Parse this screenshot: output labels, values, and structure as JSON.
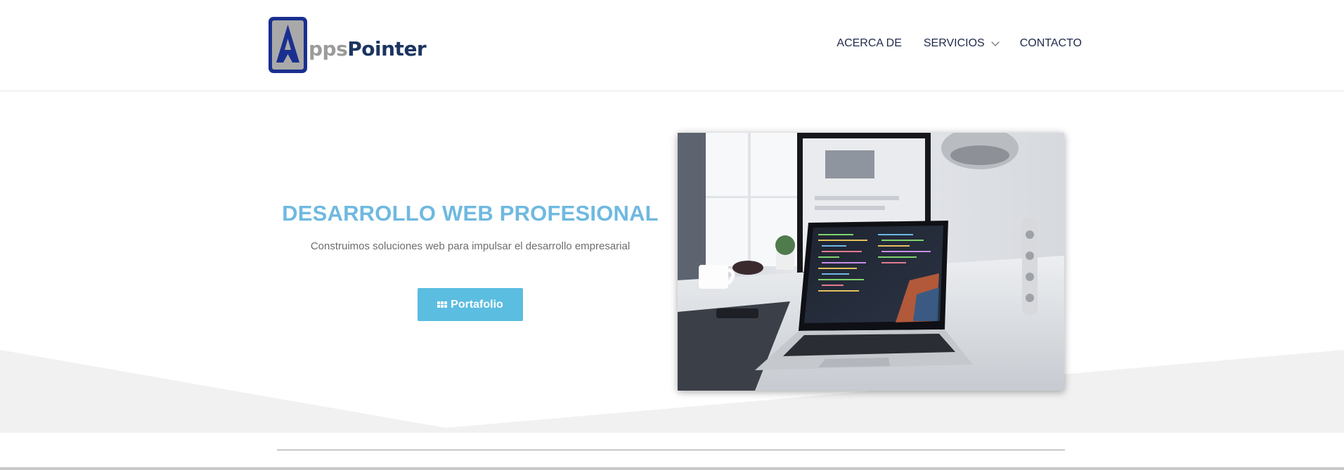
{
  "header": {
    "logo": {
      "text_part1": "pps",
      "text_part2": "Pointer",
      "alt": "AppsPointer"
    },
    "nav": [
      {
        "label": "ACERCA DE",
        "has_dropdown": false
      },
      {
        "label": "SERVICIOS",
        "has_dropdown": true
      },
      {
        "label": "CONTACTO",
        "has_dropdown": false
      }
    ]
  },
  "hero": {
    "title": "DESARROLLO WEB PROFESIONAL",
    "subtitle": "Construimos soluciones web para impulsar el desarrollo empresarial",
    "button": {
      "label": "Portafolio",
      "icon": "grid-icon"
    },
    "image": {
      "subject": "laptop-on-desk-photo"
    }
  },
  "colors": {
    "accent_title": "#6fb9e0",
    "button_bg": "#5bbde0",
    "nav_text": "#1f2a4a",
    "logo_blue": "#1a2f8f",
    "logo_gray": "#9b9b9b",
    "logo_navy": "#1c3560",
    "hero_band": "#f1f1f1"
  }
}
